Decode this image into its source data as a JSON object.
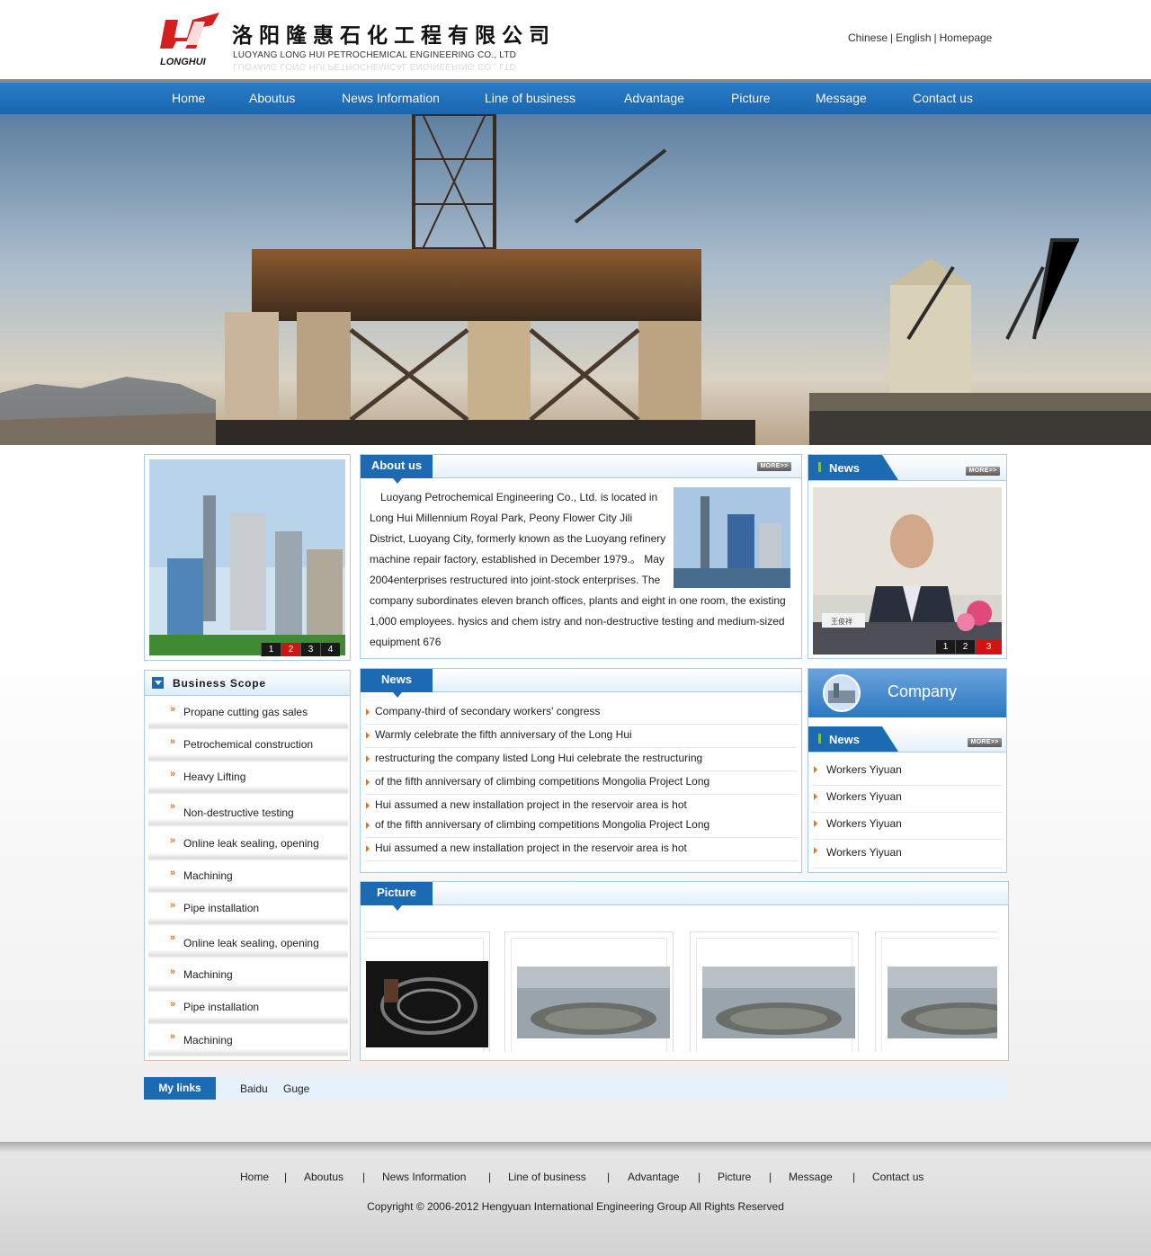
{
  "header": {
    "logo_cn": "洛阳隆惠石化工程有限公司",
    "logo_en": "LUOYANG LONG HUI PETROCHEMICAL ENGINEERING CO., LTD",
    "logo_brand": "LONGHUI",
    "top_links": [
      "Chinese",
      "English",
      "Homepage"
    ]
  },
  "nav": [
    "Home",
    "Aboutus",
    "News Information",
    "Line of business",
    "Advantage",
    "Picture",
    "Message",
    "Contact us"
  ],
  "left_slider": {
    "thumbs": [
      "1",
      "2",
      "3",
      "4"
    ],
    "active": "2"
  },
  "business_scope": {
    "title": "Business Scope",
    "items": [
      "Propane cutting gas sales",
      "Petrochemical construction",
      "Heavy Lifting",
      "Non-destructive testing",
      "Online leak sealing, opening",
      "Machining",
      "Pipe installation",
      "Online leak sealing, opening",
      "Machining",
      "Pipe installation",
      "Machining"
    ]
  },
  "about": {
    "title": "About us",
    "more": "MORE>>",
    "text": "Luoyang Petrochemical Engineering Co., Ltd. is located in Long Hui Millennium Royal Park, Peony Flower City Jili District, Luoyang City, formerly known as the Luoyang refinery machine repair factory, established in December 1979.。 May 2004enterprises restructured into joint-stock enterprises. The company subordinates eleven branch offices, plants and eight in one room, the existing 1,000 employees. hysics and chem istry and non-destructive testing and medium-sized equipment 676"
  },
  "news_top_right": {
    "title": "News",
    "more": "MORE>>",
    "thumbs": [
      "1",
      "2",
      "3"
    ],
    "active": "3",
    "nameplate": "王俊祥"
  },
  "news_center": {
    "title": "News",
    "items": [
      "Company-third of secondary workers' congress",
      "Warmly celebrate the fifth anniversary of the Long Hui",
      "restructuring the company listed Long Hui celebrate the restructuring",
      "of the fifth anniversary of climbing competitions Mongolia Project Long",
      " Hui assumed a new installation project in the reservoir area is hot",
      "of the fifth anniversary of climbing competitions Mongolia Project Long",
      " Hui assumed a new installation project in the reservoir area is hot"
    ]
  },
  "company_banner": {
    "label": "Company"
  },
  "news_right": {
    "title": "News",
    "more": "MORE>>",
    "items": [
      "Workers Yiyuan",
      "Workers Yiyuan",
      "Workers Yiyuan",
      "Workers Yiyuan"
    ]
  },
  "picture": {
    "title": "Picture"
  },
  "links": {
    "label": "My links",
    "items": [
      "Baidu",
      "Guge"
    ]
  },
  "footer": {
    "nav": [
      "Home",
      "Aboutus",
      "News Information",
      "Line of business",
      "Advantage",
      "Picture",
      "Message",
      "Contact us"
    ],
    "copyright": "Copyright © 2006-2012 Hengyuan International Engineering Group All Rights Reserved"
  },
  "colors": {
    "nav_blue": "#1c6ab2",
    "accent_orange": "#e8730c",
    "border_blue": "#a9cde9",
    "thumb_active": "#d31212"
  }
}
